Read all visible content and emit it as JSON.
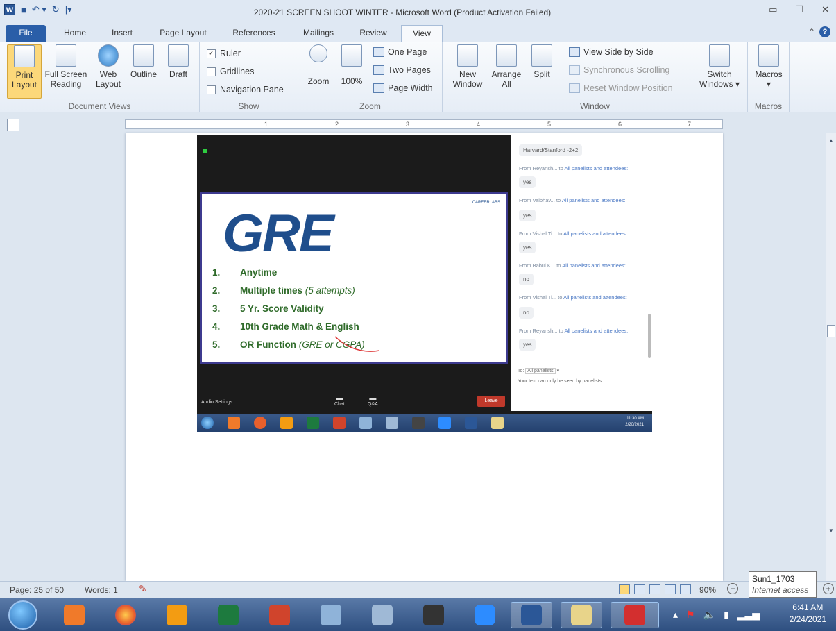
{
  "window": {
    "title": "2020-21 SCREEN SHOOT WINTER - Microsoft Word (Product Activation Failed)"
  },
  "tabs": [
    "File",
    "Home",
    "Insert",
    "Page Layout",
    "References",
    "Mailings",
    "Review",
    "View"
  ],
  "ribbon": {
    "document_views": {
      "label": "Document Views",
      "print": "Print",
      "print2": "Layout",
      "full": "Full Screen",
      "full2": "Reading",
      "web": "Web",
      "web2": "Layout",
      "outline": "Outline",
      "draft": "Draft"
    },
    "show": {
      "label": "Show",
      "ruler": "Ruler",
      "gridlines": "Gridlines",
      "nav": "Navigation Pane"
    },
    "zoom": {
      "label": "Zoom",
      "zoom": "Zoom",
      "hundred": "100%",
      "one": "One Page",
      "two": "Two Pages",
      "width": "Page Width"
    },
    "window": {
      "label": "Window",
      "new": "New",
      "new2": "Window",
      "arrange": "Arrange",
      "arrange2": "All",
      "split": "Split",
      "side": "View Side by Side",
      "sync": "Synchronous Scrolling",
      "reset": "Reset Window Position",
      "switch": "Switch",
      "switch2": "Windows"
    },
    "macros": {
      "label": "Macros",
      "macros": "Macros"
    }
  },
  "ruler_numbers": [
    "1",
    "2",
    "3",
    "4",
    "5",
    "6",
    "7"
  ],
  "slide": {
    "logo": "CAREERLABS",
    "title": "GRE",
    "items": [
      {
        "n": "1.",
        "text": "Anytime",
        "extra": ""
      },
      {
        "n": "2.",
        "text": "Multiple times",
        "extra": "(5 attempts)"
      },
      {
        "n": "3.",
        "text": "5 Yr. Score Validity",
        "extra": ""
      },
      {
        "n": "4.",
        "text": "10th Grade Math & English",
        "extra": ""
      },
      {
        "n": "5.",
        "text": "OR Function",
        "extra": "(GRE or CGPA)"
      }
    ]
  },
  "chat": {
    "first": "Harvard/Stanford -2+2",
    "messages": [
      {
        "from": "From Reyansh...",
        "to": "to",
        "target": "All panelists and attendees:",
        "reply": "yes"
      },
      {
        "from": "From Vaibhav...",
        "to": "to",
        "target": "All panelists and attendees:",
        "reply": "yes"
      },
      {
        "from": "From Vishal Ti...",
        "to": "to",
        "target": "All panelists and attendees:",
        "reply": "yes"
      },
      {
        "from": "From Babul K...",
        "to": "to",
        "target": "All panelists and attendees:",
        "reply": "no"
      },
      {
        "from": "From Vishal Ti...",
        "to": "to",
        "target": "All panelists and attendees:",
        "reply": "no"
      },
      {
        "from": "From Reyansh...",
        "to": "to",
        "target": "All panelists and attendees:",
        "reply": "yes"
      }
    ],
    "to_label": "To:",
    "to_value": "All panelists",
    "placeholder": "Your text can only be seen by panelists"
  },
  "zoom_bar": {
    "audio": "Audio Settings",
    "chat": "Chat",
    "qa": "Q&A",
    "leave": "Leave"
  },
  "inner_clock": {
    "time": "11:30 AM",
    "date": "2/20/2021"
  },
  "status": {
    "page": "Page: 25 of 50",
    "words": "Words: 1",
    "zoom": "90%"
  },
  "tooltip": {
    "line1": "Sun1_1703",
    "line2": "Internet access"
  },
  "clock": {
    "time": "6:41 AM",
    "date": "2/24/2021"
  }
}
